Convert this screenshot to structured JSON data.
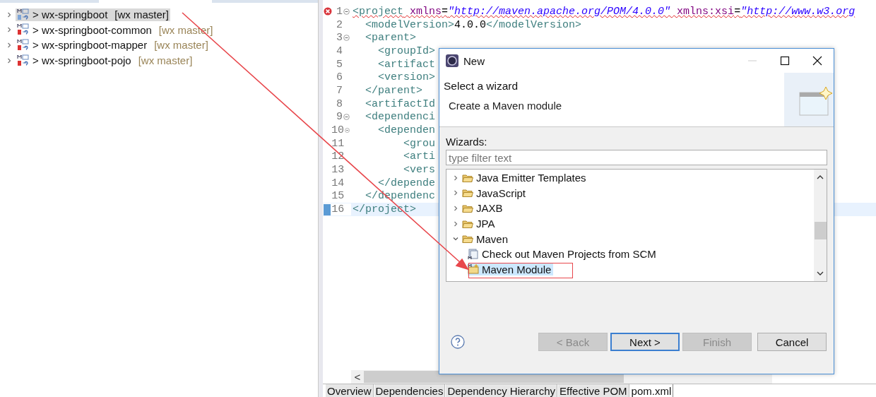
{
  "project_explorer": {
    "items": [
      {
        "label": "> wx-springboot",
        "branch": "[wx master]",
        "selected": true,
        "expanded": false
      },
      {
        "label": "> wx-springboot-common",
        "branch": "[wx master]",
        "selected": false,
        "expanded": false
      },
      {
        "label": "> wx-springboot-mapper",
        "branch": "[wx master]",
        "selected": false,
        "expanded": false
      },
      {
        "label": "> wx-springboot-pojo",
        "branch": "[wx master]",
        "selected": false,
        "expanded": false
      }
    ]
  },
  "editor": {
    "lines": [
      {
        "number": "1",
        "error": true,
        "fold": true,
        "current": false,
        "segments": [
          {
            "kind": "tag",
            "text": "<project"
          },
          {
            "kind": "attr",
            "text": " xmlns"
          },
          {
            "kind": "plain",
            "text": "="
          },
          {
            "kind": "value",
            "text": "\"http://maven.apache.org/POM/4.0.0\""
          },
          {
            "kind": "attr",
            "text": " xmlns:xsi"
          },
          {
            "kind": "plain",
            "text": "="
          },
          {
            "kind": "value",
            "text": "\"http://www.w3.org"
          }
        ]
      },
      {
        "number": "2",
        "error": false,
        "fold": false,
        "current": false,
        "segments": [
          {
            "kind": "tag",
            "text": "  <modelVersion>"
          },
          {
            "kind": "plain",
            "text": "4.0.0"
          },
          {
            "kind": "tag",
            "text": "</modelVersion>"
          }
        ]
      },
      {
        "number": "3",
        "error": false,
        "fold": true,
        "current": false,
        "segments": [
          {
            "kind": "tag",
            "text": "  <parent>"
          }
        ]
      },
      {
        "number": "4",
        "error": false,
        "fold": false,
        "current": false,
        "segments": [
          {
            "kind": "tag",
            "text": "    <groupId>"
          }
        ]
      },
      {
        "number": "5",
        "error": false,
        "fold": false,
        "current": false,
        "segments": [
          {
            "kind": "tag",
            "text": "    <artifact"
          }
        ]
      },
      {
        "number": "6",
        "error": false,
        "fold": false,
        "current": false,
        "segments": [
          {
            "kind": "tag",
            "text": "    <version>"
          }
        ]
      },
      {
        "number": "7",
        "error": false,
        "fold": false,
        "current": false,
        "segments": [
          {
            "kind": "tag",
            "text": "  </parent>"
          }
        ]
      },
      {
        "number": "8",
        "error": false,
        "fold": false,
        "current": false,
        "segments": [
          {
            "kind": "tag",
            "text": "  <artifactId"
          }
        ]
      },
      {
        "number": "9",
        "error": false,
        "fold": true,
        "current": false,
        "segments": [
          {
            "kind": "tag",
            "text": "  <dependenci"
          }
        ]
      },
      {
        "number": "10",
        "error": false,
        "fold": true,
        "current": false,
        "segments": [
          {
            "kind": "tag",
            "text": "    <dependen"
          }
        ]
      },
      {
        "number": "11",
        "error": false,
        "fold": false,
        "current": false,
        "segments": [
          {
            "kind": "tag",
            "text": "        <grou"
          }
        ]
      },
      {
        "number": "12",
        "error": false,
        "fold": false,
        "current": false,
        "segments": [
          {
            "kind": "tag",
            "text": "        <arti"
          }
        ]
      },
      {
        "number": "13",
        "error": false,
        "fold": false,
        "current": false,
        "segments": [
          {
            "kind": "tag",
            "text": "        <vers"
          }
        ]
      },
      {
        "number": "14",
        "error": false,
        "fold": false,
        "current": false,
        "segments": [
          {
            "kind": "tag",
            "text": "    </depende"
          }
        ]
      },
      {
        "number": "15",
        "error": false,
        "fold": false,
        "current": false,
        "segments": [
          {
            "kind": "tag",
            "text": "  </dependenc"
          }
        ]
      },
      {
        "number": "16",
        "error": false,
        "fold": false,
        "current": true,
        "segments": [
          {
            "kind": "tag",
            "text": "</project>"
          }
        ]
      }
    ],
    "scroll_left": "<",
    "tabs": [
      {
        "label": "Overview",
        "selected": false
      },
      {
        "label": "Dependencies",
        "selected": false
      },
      {
        "label": "Dependency Hierarchy",
        "selected": false
      },
      {
        "label": "Effective POM",
        "selected": false
      },
      {
        "label": "pom.xml",
        "selected": true
      }
    ]
  },
  "dialog": {
    "title": "New",
    "heading": "Select a wizard",
    "description": "Create a Maven module",
    "wizards_label": "Wizards:",
    "filter": {
      "placeholder": "type filter text"
    },
    "tree": [
      {
        "label": "Java Emitter Templates",
        "kind": "folder",
        "expanded": false,
        "selected": false
      },
      {
        "label": "JavaScript",
        "kind": "folder",
        "expanded": false,
        "selected": false
      },
      {
        "label": "JAXB",
        "kind": "folder",
        "expanded": false,
        "selected": false
      },
      {
        "label": "JPA",
        "kind": "folder",
        "expanded": false,
        "selected": false
      },
      {
        "label": "Maven",
        "kind": "folder",
        "expanded": true,
        "selected": false,
        "children": [
          {
            "label": "Check out Maven Projects from SCM",
            "kind": "scm",
            "selected": false
          },
          {
            "label": "Maven Module",
            "kind": "module",
            "selected": true
          }
        ]
      }
    ],
    "buttons": [
      {
        "label": "< Back",
        "disabled": true,
        "default": false
      },
      {
        "label": "Next >",
        "disabled": false,
        "default": true
      },
      {
        "label": "Finish",
        "disabled": true,
        "default": false
      },
      {
        "label": "Cancel",
        "disabled": false,
        "default": false
      }
    ]
  }
}
